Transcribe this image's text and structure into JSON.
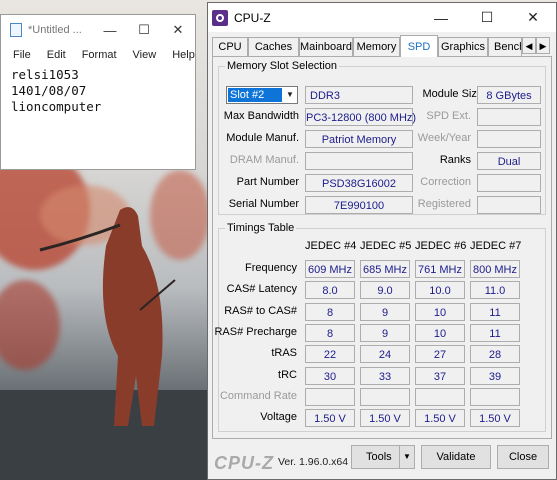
{
  "notepad": {
    "title": "*Untitled ...",
    "controls": {
      "minimize": "—",
      "maximize": "☐",
      "close": "✕"
    },
    "menu": [
      "File",
      "Edit",
      "Format",
      "View",
      "Help"
    ],
    "lines": [
      "relsi1053",
      "1401/08/07",
      "lioncomputer"
    ]
  },
  "cpuz": {
    "title": "CPU-Z",
    "controls": {
      "minimize": "—",
      "maximize": "☐",
      "close": "✕"
    },
    "tabs": [
      "CPU",
      "Caches",
      "Mainboard",
      "Memory",
      "SPD",
      "Graphics",
      "Bench"
    ],
    "active_tab": "SPD",
    "tab_arrows": [
      "◀",
      "▶"
    ],
    "slot_section": {
      "title": "Memory Slot Selection",
      "slot_value": "Slot #2",
      "memory_type": "DDR3",
      "module_size_label": "Module Size",
      "module_size": "8 GBytes",
      "max_bandwidth_label": "Max Bandwidth",
      "max_bandwidth": "PC3-12800 (800 MHz)",
      "spd_ext_label": "SPD Ext.",
      "spd_ext": "",
      "module_manuf_label": "Module Manuf.",
      "module_manuf": "Patriot Memory",
      "week_year_label": "Week/Year",
      "week_year": "",
      "dram_manuf_label": "DRAM Manuf.",
      "dram_manuf": "",
      "ranks_label": "Ranks",
      "ranks": "Dual",
      "part_number_label": "Part Number",
      "part_number": "PSD38G16002",
      "correction_label": "Correction",
      "correction": "",
      "serial_number_label": "Serial Number",
      "serial_number": "7E990100",
      "registered_label": "Registered",
      "registered": ""
    },
    "timings": {
      "title": "Timings Table",
      "columns": [
        "JEDEC #4",
        "JEDEC #5",
        "JEDEC #6",
        "JEDEC #7"
      ],
      "rows": [
        {
          "label": "Frequency",
          "dim": false,
          "values": [
            "609 MHz",
            "685 MHz",
            "761 MHz",
            "800 MHz"
          ]
        },
        {
          "label": "CAS# Latency",
          "dim": false,
          "values": [
            "8.0",
            "9.0",
            "10.0",
            "11.0"
          ]
        },
        {
          "label": "RAS# to CAS#",
          "dim": false,
          "values": [
            "8",
            "9",
            "10",
            "11"
          ]
        },
        {
          "label": "RAS# Precharge",
          "dim": false,
          "values": [
            "8",
            "9",
            "10",
            "11"
          ]
        },
        {
          "label": "tRAS",
          "dim": false,
          "values": [
            "22",
            "24",
            "27",
            "28"
          ]
        },
        {
          "label": "tRC",
          "dim": false,
          "values": [
            "30",
            "33",
            "37",
            "39"
          ]
        },
        {
          "label": "Command Rate",
          "dim": true,
          "values": [
            "",
            "",
            "",
            ""
          ]
        },
        {
          "label": "Voltage",
          "dim": false,
          "values": [
            "1.50 V",
            "1.50 V",
            "1.50 V",
            "1.50 V"
          ]
        }
      ]
    },
    "footer": {
      "brand": "CPU-Z",
      "version": "Ver. 1.96.0.x64",
      "tools_label": "Tools",
      "tools_arrow": "▼",
      "validate_label": "Validate",
      "close_label": "Close"
    },
    "colors": {
      "value_text": "#1c1c8c",
      "active_tab": "#1c6fc4",
      "selection": "#0f74d8",
      "icon": "#5b2e8c"
    }
  }
}
